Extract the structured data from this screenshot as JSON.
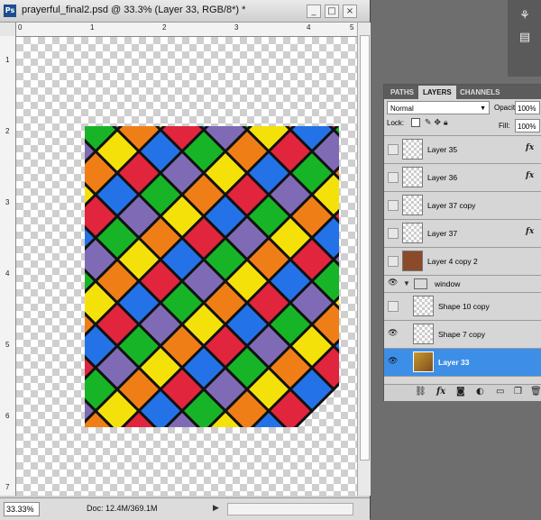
{
  "document": {
    "app_icon": "Ps",
    "title": "prayerful_final2.psd @ 33.3% (Layer 33, RGB/8*) *",
    "window_buttons": [
      "_",
      "□",
      "×"
    ],
    "ruler_top": [
      "0",
      "1",
      "2",
      "3",
      "4",
      "5"
    ],
    "ruler_left": [
      "1",
      "2",
      "3",
      "4",
      "5",
      "6",
      "7"
    ],
    "zoom": "33.33%",
    "doc_info": "Doc: 12.4M/369.1M",
    "art_colors": [
      "#f5e10a",
      "#7f6bb5",
      "#e0253c",
      "#f07e16",
      "#18b427",
      "#2472e8"
    ]
  },
  "toolstrip": {
    "icons": [
      "tool-preset-icon",
      "clone-source-icon"
    ]
  },
  "layers_panel": {
    "tabs": [
      "PATHS",
      "LAYERS",
      "CHANNELS"
    ],
    "active_tab": "LAYERS",
    "blend_mode": "Normal",
    "opacity_label": "Opacity:",
    "opacity": "100%",
    "lock_label": "Lock:",
    "fill_label": "Fill:",
    "fill": "100%",
    "layers": [
      {
        "name": "Layer 35",
        "visible": false,
        "fx": true,
        "thumb": "transparent"
      },
      {
        "name": "Layer 36",
        "visible": false,
        "fx": true,
        "thumb": "transparent"
      },
      {
        "name": "Layer 37 copy",
        "visible": false,
        "fx": false,
        "thumb": "transparent"
      },
      {
        "name": "Layer 37",
        "visible": false,
        "fx": true,
        "thumb": "transparent"
      },
      {
        "name": "Layer 4 copy 2",
        "visible": false,
        "fx": false,
        "thumb": "brown"
      }
    ],
    "group": {
      "name": "window",
      "visible": true
    },
    "group_layers": [
      {
        "name": "Shape 10 copy",
        "visible": false,
        "selected": false
      },
      {
        "name": "Shape 7 copy",
        "visible": true,
        "selected": false
      },
      {
        "name": "Layer 33",
        "visible": true,
        "selected": true
      }
    ],
    "fx_label": "fx",
    "bottom_icons": [
      "link-icon",
      "fx-icon",
      "mask-icon",
      "adjustment-icon",
      "group-icon",
      "new-layer-icon",
      "trash-icon"
    ]
  }
}
